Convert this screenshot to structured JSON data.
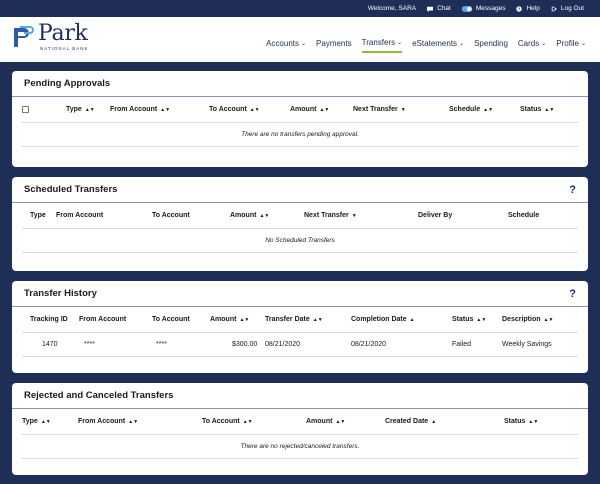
{
  "topbar": {
    "welcome": "Welcome, SARA",
    "chat": "Chat",
    "messages": "Messages",
    "help": "Help",
    "logout": "Log Out"
  },
  "logo": {
    "name": "Park",
    "sub": "NATIONAL BANK"
  },
  "nav": [
    {
      "label": "Accounts",
      "chevron": true
    },
    {
      "label": "Payments",
      "chevron": false
    },
    {
      "label": "Transfers",
      "chevron": true,
      "active": true
    },
    {
      "label": "eStatements",
      "chevron": true
    },
    {
      "label": "Spending",
      "chevron": false
    },
    {
      "label": "Cards",
      "chevron": true
    },
    {
      "label": "Profile",
      "chevron": true
    }
  ],
  "pending": {
    "title": "Pending Approvals",
    "columns": [
      "Type",
      "From Account",
      "To Account",
      "Amount",
      "Next Transfer",
      "Schedule",
      "Status"
    ],
    "empty": "There are no transfers pending approval."
  },
  "scheduled": {
    "title": "Scheduled Transfers",
    "help": "?",
    "columns": [
      "Type",
      "From Account",
      "To Account",
      "Amount",
      "Next Transfer",
      "Deliver By",
      "Schedule"
    ],
    "empty": "No Scheduled Transfers"
  },
  "history": {
    "title": "Transfer History",
    "help": "?",
    "columns": [
      "Tracking ID",
      "From Account",
      "To Account",
      "Amount",
      "Transfer Date",
      "Completion Date",
      "Status",
      "Description"
    ],
    "rows": [
      {
        "tracking_id": "1470",
        "from": "****",
        "to": "****",
        "amount": "$300.00",
        "transfer_date": "08/21/2020",
        "completion_date": "08/21/2020",
        "status": "Failed",
        "description": "Weekly Savings"
      }
    ]
  },
  "rejected": {
    "title": "Rejected and Canceled Transfers",
    "columns": [
      "Type",
      "From Account",
      "To Account",
      "Amount",
      "Created Date",
      "Status"
    ],
    "empty": "There are no rejected/canceled transfers."
  },
  "colors": {
    "brand": "#1f2e57",
    "accent": "#8bbf3c"
  }
}
